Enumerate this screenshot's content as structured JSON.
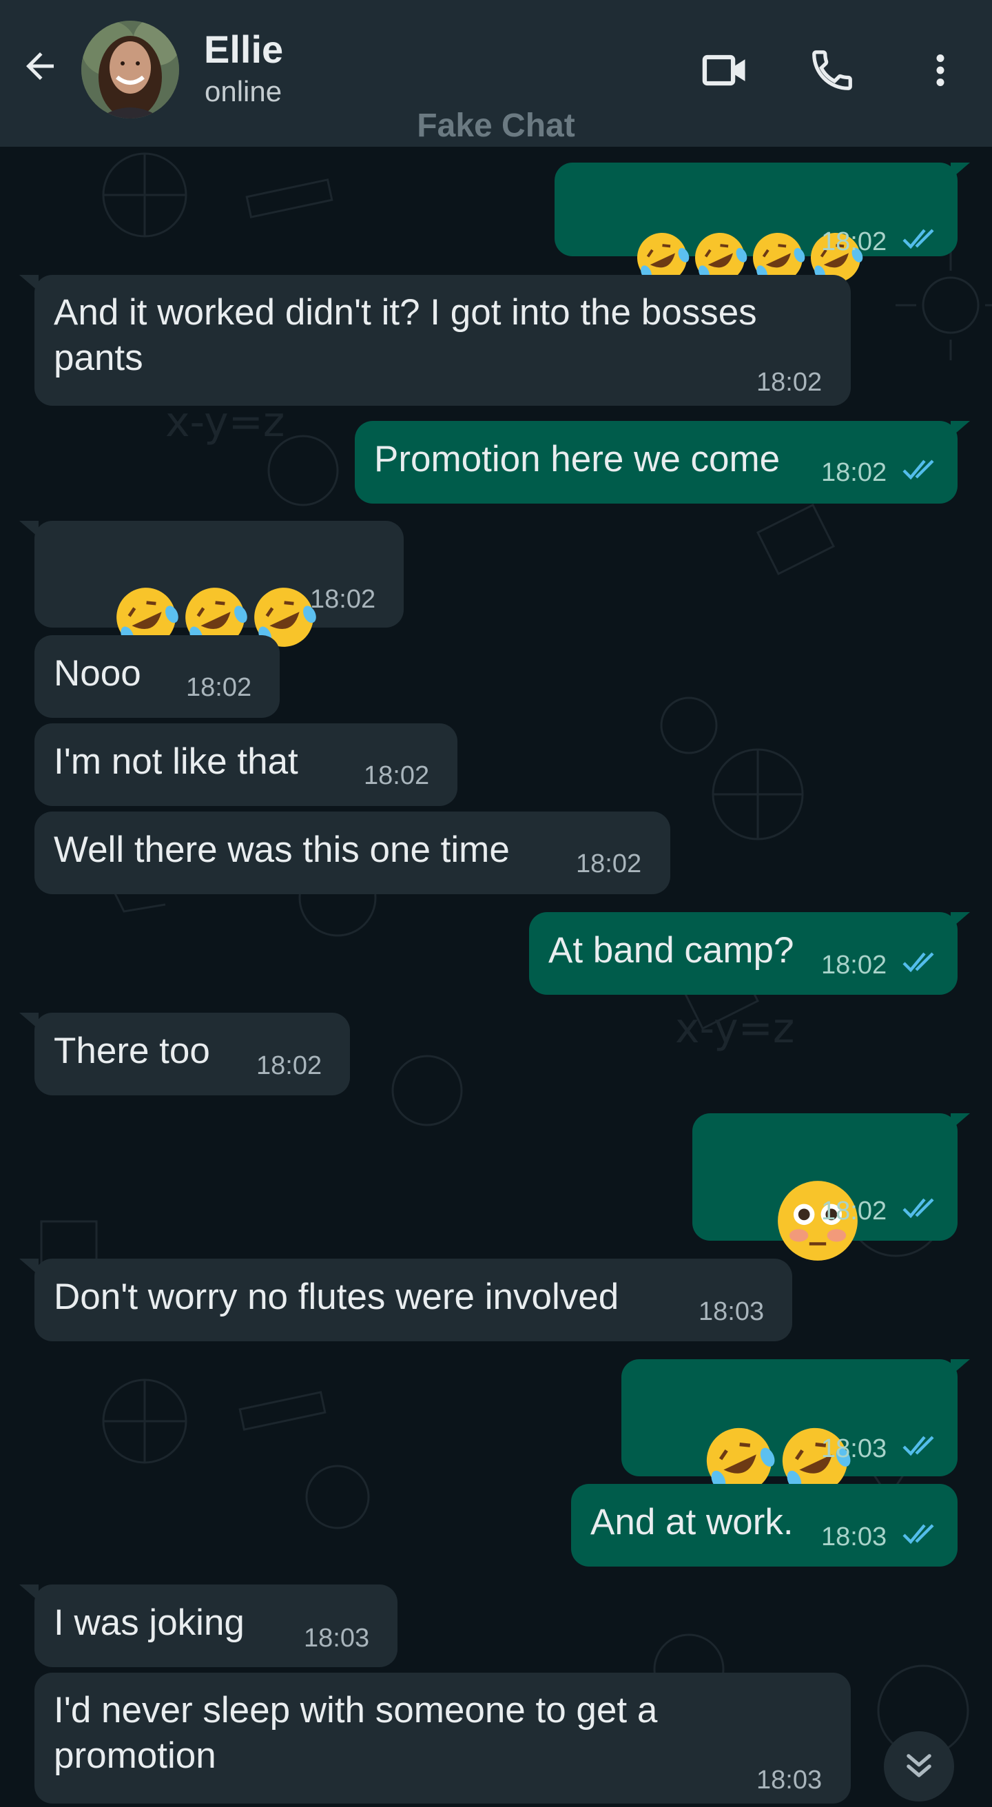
{
  "header": {
    "contact_name": "Ellie",
    "contact_status": "online",
    "watermark": "Fake Chat",
    "back_icon": "arrow-left-icon",
    "video_icon": "video-camera-icon",
    "call_icon": "phone-icon",
    "menu_icon": "more-vertical-icon"
  },
  "colors": {
    "header_bg": "#1f2c34",
    "chat_bg": "#0b141a",
    "incoming_bubble": "#202c33",
    "outgoing_bubble": "#005c4b",
    "read_tick": "#53bdeb"
  },
  "messages": [
    {
      "dir": "out",
      "text": "",
      "emoji": "rolling-on-floor-laughing",
      "emoji_count": 4,
      "time": "18:02",
      "status": "read"
    },
    {
      "dir": "in",
      "text": "And it worked didn't it? I got into the bosses pants",
      "time": "18:02"
    },
    {
      "dir": "out",
      "text": "Promotion here we come",
      "time": "18:02",
      "status": "read"
    },
    {
      "dir": "in",
      "text": "",
      "emoji": "rolling-on-floor-laughing",
      "emoji_count": 3,
      "time": "18:02"
    },
    {
      "dir": "in",
      "text": "Nooo",
      "time": "18:02"
    },
    {
      "dir": "in",
      "text": "I'm not like that",
      "time": "18:02"
    },
    {
      "dir": "in",
      "text": "Well there was this one time",
      "time": "18:02"
    },
    {
      "dir": "out",
      "text": "At band camp?",
      "time": "18:02",
      "status": "read"
    },
    {
      "dir": "in",
      "text": "There too",
      "time": "18:02"
    },
    {
      "dir": "out",
      "text": "",
      "emoji": "flushed-face",
      "emoji_count": 1,
      "time": "18:02",
      "status": "read"
    },
    {
      "dir": "in",
      "text": "Don't worry no flutes were involved",
      "time": "18:03"
    },
    {
      "dir": "out",
      "text": "",
      "emoji": "rolling-on-floor-laughing",
      "emoji_count": 2,
      "time": "18:03",
      "status": "read"
    },
    {
      "dir": "out",
      "text": "And at work.",
      "time": "18:03",
      "status": "read"
    },
    {
      "dir": "in",
      "text": "I was joking",
      "time": "18:03"
    },
    {
      "dir": "in",
      "text": "I'd never sleep with someone to get a promotion",
      "time": "18:03"
    }
  ],
  "scroll_button_icon": "double-chevron-down-icon"
}
